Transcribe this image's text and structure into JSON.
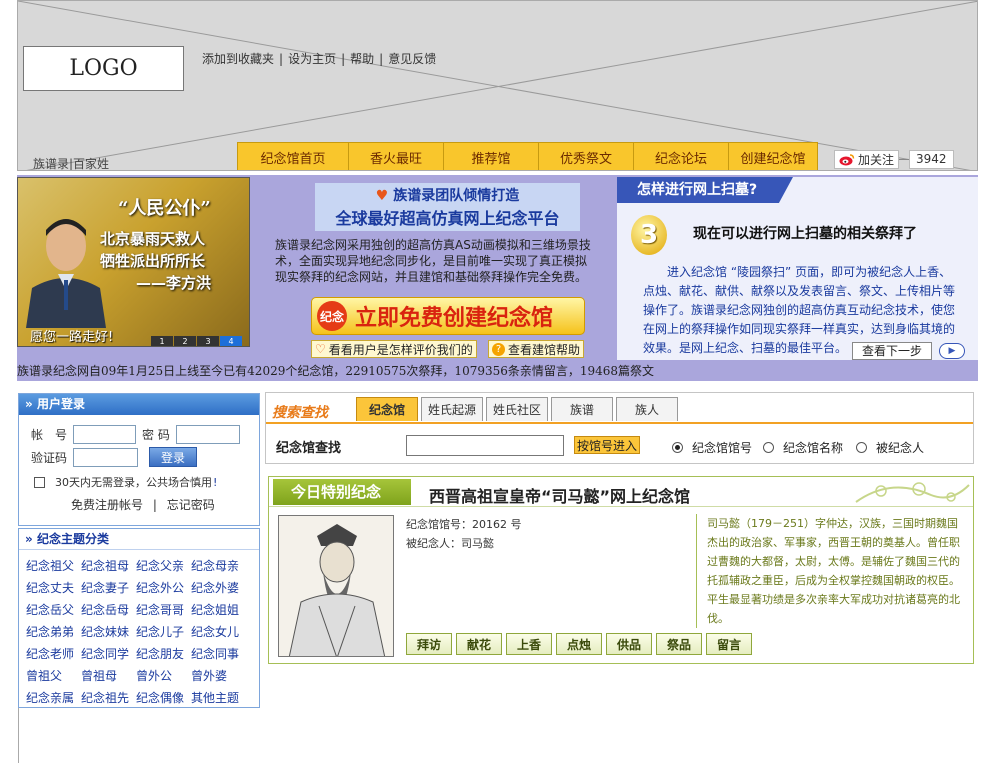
{
  "header": {
    "logo": "LOGO",
    "top_links": [
      "添加到收藏夹",
      "设为主页",
      "帮助",
      "意见反馈"
    ],
    "brand_small": "族谱录|百家姓",
    "nav": [
      "纪念馆首页",
      "香火最旺",
      "推荐馆",
      "优秀祭文",
      "纪念论坛",
      "创建纪念馆"
    ],
    "follow_label": "加关注",
    "follow_count": "3942"
  },
  "banner": {
    "photo": {
      "quote": "“人民公仆”",
      "lines": [
        "北京暴雨天救人",
        "牺牲派出所所长",
        "——李方洪"
      ],
      "bless": "愿您一路走好!",
      "pager": [
        "1",
        "2",
        "3",
        "4"
      ]
    },
    "mid": {
      "title_line1": "族谱录团队倾情打造",
      "title_line2": "全球最好超高仿真网上纪念平台",
      "description": "族谱录纪念网采用独创的超高仿真AS动画模拟和三维场景技术，全面实现异地纪念同步化，是目前唯一实现了真正模拟现实祭拜的纪念网站，并且建馆和基础祭拜操作完全免费。",
      "create_button": "立即免费创建纪念馆",
      "seal_text": "纪念",
      "eval_button": "看看用户是怎样评价我们的",
      "help_button": "查看建馆帮助"
    },
    "right": {
      "title": "怎样进行网上扫墓?",
      "step": "3",
      "subtitle": "现在可以进行网上扫墓的相关祭拜了",
      "description": "进入纪念馆 “陵园祭扫” 页面，即可为被纪念人上香、点烛、献花、献供、献祭以及发表留言、祭文、上传相片等操作了。族谱录纪念网独创的超高仿真互动纪念技术，使您在网上的祭拜操作如同现实祭拜一样真实，达到身临其境的效果。是网上纪念、扫墓的最佳平台。",
      "next_button": "查看下一步"
    },
    "stats": "族谱录纪念网自09年1月25日上线至今已有42029个纪念馆，22910575次祭拜，1079356条亲情留言，19468篇祭文"
  },
  "login": {
    "title": "用户登录",
    "account_label": "帐　号",
    "password_label": "密 码",
    "captcha_label": "验证码",
    "submit": "登录",
    "remember": "30天内无需登录，公共场合慎用",
    "register": "免费注册帐号",
    "forgot": "忘记密码"
  },
  "topics": {
    "title": "纪念主题分类",
    "items": [
      "纪念祖父",
      "纪念祖母",
      "纪念父亲",
      "纪念母亲",
      "纪念丈夫",
      "纪念妻子",
      "纪念外公",
      "纪念外婆",
      "纪念岳父",
      "纪念岳母",
      "纪念哥哥",
      "纪念姐姐",
      "纪念弟弟",
      "纪念妹妹",
      "纪念儿子",
      "纪念女儿",
      "纪念老师",
      "纪念同学",
      "纪念朋友",
      "纪念同事",
      "曾祖父",
      "曾祖母",
      "曾外公",
      "曾外婆",
      "纪念亲属",
      "纪念祖先",
      "纪念偶像",
      "其他主题"
    ]
  },
  "search": {
    "title": "搜索查找",
    "tabs": [
      "纪念馆",
      "姓氏起源",
      "姓氏社区",
      "族谱",
      "族人"
    ],
    "active_tab": 0,
    "label": "纪念馆查找",
    "button": "按馆号进入",
    "options": [
      "纪念馆馆号",
      "纪念馆名称",
      "被纪念人"
    ],
    "selected_option": 0
  },
  "memorial": {
    "tag": "今日特别纪念",
    "name": "西晋高祖宣皇帝“司马懿”网上纪念馆",
    "number_line": "纪念馆馆号：20162 号",
    "person_line": "被纪念人：司马懿",
    "description": "司马懿（179－251）字仲达，汉族，三国时期魏国杰出的政治家、军事家，西晋王朝的奠基人。曾任职过曹魏的大都督，太尉，太傅。是辅佐了魏国三代的托孤辅政之重臣，后成为全权掌控魏国朝政的权臣。平生最显著功绩是多次亲率大军成功对抗诸葛亮的北伐。",
    "actions": [
      "拜访",
      "献花",
      "上香",
      "点烛",
      "供品",
      "祭品",
      "留言"
    ]
  }
}
